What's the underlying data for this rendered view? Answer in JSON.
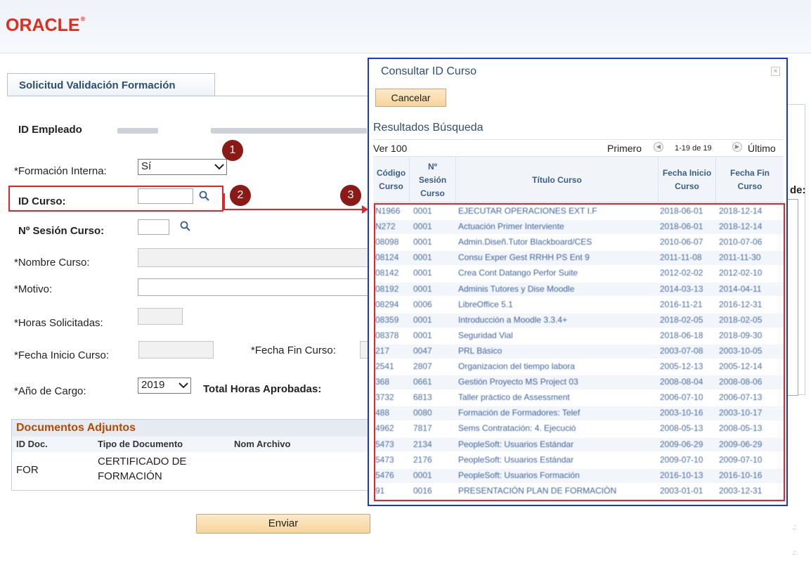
{
  "header": {
    "logo_text": "ORACLE",
    "logo_mark": "®"
  },
  "page": {
    "tab_title": "Solicitud Validación Formación"
  },
  "form": {
    "id_empleado_label": "ID Empleado",
    "formacion_interna_label": "*Formación Interna:",
    "formacion_interna_value": "Sí",
    "id_curso_label": "ID Curso:",
    "num_sesion_label": "Nº Sesión Curso:",
    "nombre_curso_label": "*Nombre Curso:",
    "motivo_label": "*Motivo:",
    "horas_solicitadas_label": "*Horas Solicitadas:",
    "fecha_inicio_label": "*Fecha Inicio Curso:",
    "fecha_fin_label": "*Fecha Fin Curso:",
    "anio_cargo_label": "*Año de Cargo:",
    "anio_cargo_value": "2019",
    "total_horas_label": "Total Horas Aprobadas:",
    "de_label": "de:"
  },
  "documents": {
    "title": "Documentos Adjuntos",
    "columns": [
      "ID Doc.",
      "Tipo de Documento",
      "Nom Archivo"
    ],
    "rows": [
      {
        "id": "FOR",
        "tipo_line1": "CERTIFICADO DE",
        "tipo_line2": "FORMACIÓN"
      }
    ]
  },
  "buttons": {
    "enviar": "Enviar"
  },
  "callouts": [
    "1",
    "2",
    "3"
  ],
  "modal": {
    "title": "Consultar ID Curso",
    "close": "×",
    "cancel_label": "Cancelar",
    "results_title": "Resultados Búsqueda",
    "ver": "Ver 100",
    "primero": "Primero",
    "range": "1-19 de 19",
    "ultimo": "Último",
    "columns": [
      {
        "line1": "Código",
        "line2": "Curso",
        "line3": ""
      },
      {
        "line1": "Nº",
        "line2": "Sesión",
        "line3": "Curso"
      },
      {
        "line1": "Título Curso",
        "line2": "",
        "line3": ""
      },
      {
        "line1": "Fecha Inicio",
        "line2": "Curso",
        "line3": ""
      },
      {
        "line1": "Fecha Fin",
        "line2": "Curso",
        "line3": ""
      }
    ],
    "rows": [
      {
        "codigo": "N1966",
        "sesion": "0001",
        "titulo": "EJECUTAR OPERACIONES EXT I.F",
        "inicio": "2018-06-01",
        "fin": "2018-12-14"
      },
      {
        "codigo": "N272",
        "sesion": "0001",
        "titulo": "Actuación Primer Interviente",
        "inicio": "2018-06-01",
        "fin": "2018-12-14"
      },
      {
        "codigo": "08098",
        "sesion": "0001",
        "titulo": "Admin.Diseñ.Tutor Blackboard/CES",
        "inicio": "2010-06-07",
        "fin": "2010-07-06"
      },
      {
        "codigo": "08124",
        "sesion": "0001",
        "titulo": "Consu Exper Gest RRHH PS Ent 9",
        "inicio": "2011-11-08",
        "fin": "2011-11-30"
      },
      {
        "codigo": "08142",
        "sesion": "0001",
        "titulo": "Crea Cont Datango Perfor Suite",
        "inicio": "2012-02-02",
        "fin": "2012-02-10"
      },
      {
        "codigo": "08192",
        "sesion": "0001",
        "titulo": "Adminis Tutores y Dise Moodle",
        "inicio": "2014-03-13",
        "fin": "2014-04-11"
      },
      {
        "codigo": "08294",
        "sesion": "0006",
        "titulo": "LibreOffice 5.1",
        "inicio": "2016-11-21",
        "fin": "2016-12-31"
      },
      {
        "codigo": "08359",
        "sesion": "0001",
        "titulo": "Introducción a Moodle 3.3.4+",
        "inicio": "2018-02-05",
        "fin": "2018-02-05"
      },
      {
        "codigo": "08378",
        "sesion": "0001",
        "titulo": "Seguridad Vial",
        "inicio": "2018-06-18",
        "fin": "2018-09-30"
      },
      {
        "codigo": "217",
        "sesion": "0047",
        "titulo": "PRL Básico",
        "inicio": "2003-07-08",
        "fin": "2003-10-05"
      },
      {
        "codigo": "2541",
        "sesion": "2807",
        "titulo": "Organizacion del tiempo labora",
        "inicio": "2005-12-13",
        "fin": "2005-12-14"
      },
      {
        "codigo": "368",
        "sesion": "0661",
        "titulo": "Gestión Proyecto MS Project 03",
        "inicio": "2008-08-04",
        "fin": "2008-08-06"
      },
      {
        "codigo": "3732",
        "sesion": "6813",
        "titulo": "Taller práctico de Assessment",
        "inicio": "2006-07-10",
        "fin": "2006-07-13"
      },
      {
        "codigo": "488",
        "sesion": "0080",
        "titulo": "Formación de Formadores: Telef",
        "inicio": "2003-10-16",
        "fin": "2003-10-17"
      },
      {
        "codigo": "4962",
        "sesion": "7817",
        "titulo": "Sems Contratación: 4. Ejecució",
        "inicio": "2008-05-13",
        "fin": "2008-05-13"
      },
      {
        "codigo": "5473",
        "sesion": "2134",
        "titulo": "PeopleSoft: Usuarios Estándar",
        "inicio": "2009-06-29",
        "fin": "2009-06-29"
      },
      {
        "codigo": "5473",
        "sesion": "2176",
        "titulo": "PeopleSoft: Usuarios Estándar",
        "inicio": "2009-07-10",
        "fin": "2009-07-10"
      },
      {
        "codigo": "5476",
        "sesion": "0001",
        "titulo": "PeopleSoft: Usuarios Formación",
        "inicio": "2016-10-13",
        "fin": "2016-10-16"
      },
      {
        "codigo": "91",
        "sesion": "0016",
        "titulo": "PRESENTACIÓN PLAN DE FORMACIÓN",
        "inicio": "2003-01-01",
        "fin": "2003-12-31"
      }
    ]
  },
  "colors": {
    "oracle_red": "#e22b1b",
    "callout": "#8b1a17",
    "highlight": "#e52329",
    "modal_border": "#1a36d6"
  }
}
